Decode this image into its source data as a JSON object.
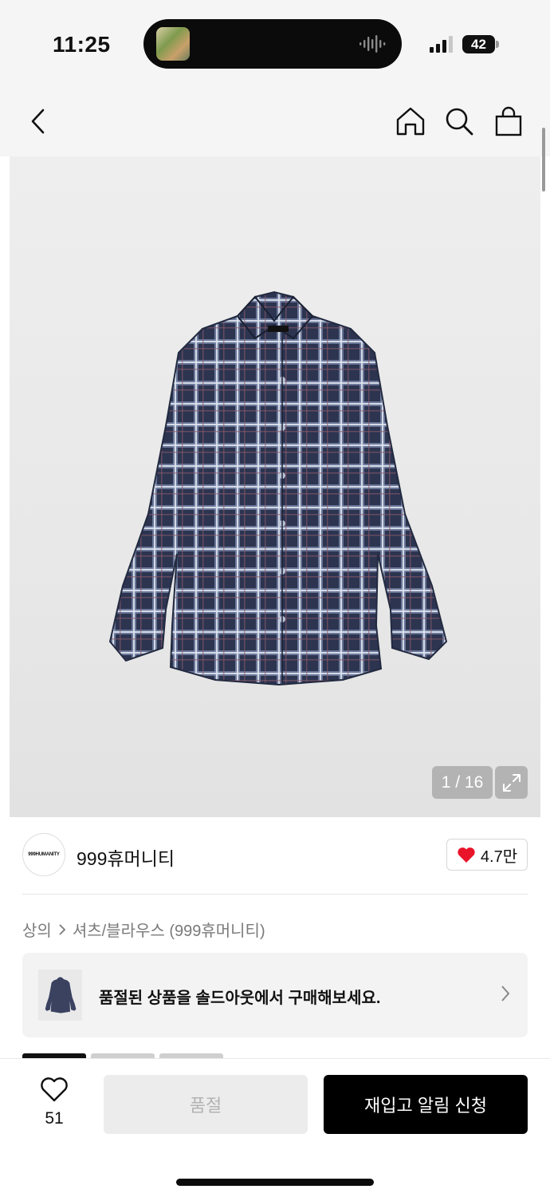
{
  "status_bar": {
    "time": "11:25",
    "battery": "42"
  },
  "nav": {
    "icons": [
      "back-icon",
      "home-icon",
      "search-icon",
      "shopping-bag-icon"
    ]
  },
  "gallery": {
    "counter": "1 / 16",
    "expand_icon": "expand-icon"
  },
  "brand": {
    "logo_text": "999HUMANITY",
    "name": "999휴머니티",
    "likes": "4.7만",
    "like_color": "#e8142a"
  },
  "breadcrumb": {
    "category": "상의",
    "subcategory": "셔츠/블라우스 (999휴머니티)"
  },
  "soldout_banner": {
    "text": "품절된 상품을 솔드아웃에서 구매해보세요."
  },
  "bottom_bar": {
    "wish_count": "51",
    "soldout_label": "품절",
    "restock_label": "재입고 알림 신청"
  },
  "colors": {
    "accent": "#000000",
    "disabled_bg": "#ececec",
    "disabled_text": "#b3b3b3"
  }
}
